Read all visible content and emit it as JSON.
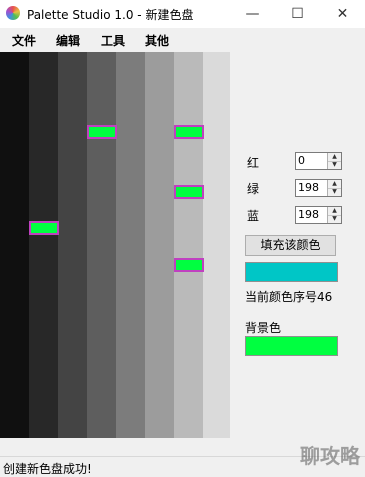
{
  "window": {
    "title": "Palette Studio 1.0 - 新建色盘",
    "controls": {
      "minimize": "—",
      "maximize": "☐",
      "close": "✕"
    }
  },
  "menu": [
    "文件",
    "编辑",
    "工具",
    "其他"
  ],
  "palette": {
    "stripe_colors": [
      "#101010",
      "#282828",
      "#444444",
      "#5e5e5e",
      "#7c7c7c",
      "#9c9c9c",
      "#bababa",
      "#dadada"
    ],
    "swatch_color": "#00ff40",
    "swatch_border": "#c040c0",
    "selected_swatches": [
      {
        "stripe": 1,
        "row": "lower"
      },
      {
        "stripe": 3,
        "row": "top"
      },
      {
        "stripe": 6,
        "row": "top"
      },
      {
        "stripe": 6,
        "row": "middle"
      },
      {
        "stripe": 6,
        "row": "bottom"
      }
    ]
  },
  "color_editor": {
    "red_label": "红",
    "red_value": "0",
    "green_label": "绿",
    "green_value": "198",
    "blue_label": "蓝",
    "blue_value": "198",
    "fill_button": "填充该颜色",
    "current_color": "#00c6c6",
    "current_index_text": "当前颜色序号46",
    "background_label": "背景色",
    "background_color": "#00ff40"
  },
  "status": {
    "text": "创建新色盘成功!"
  },
  "watermark": {
    "text": "聊攻略"
  }
}
